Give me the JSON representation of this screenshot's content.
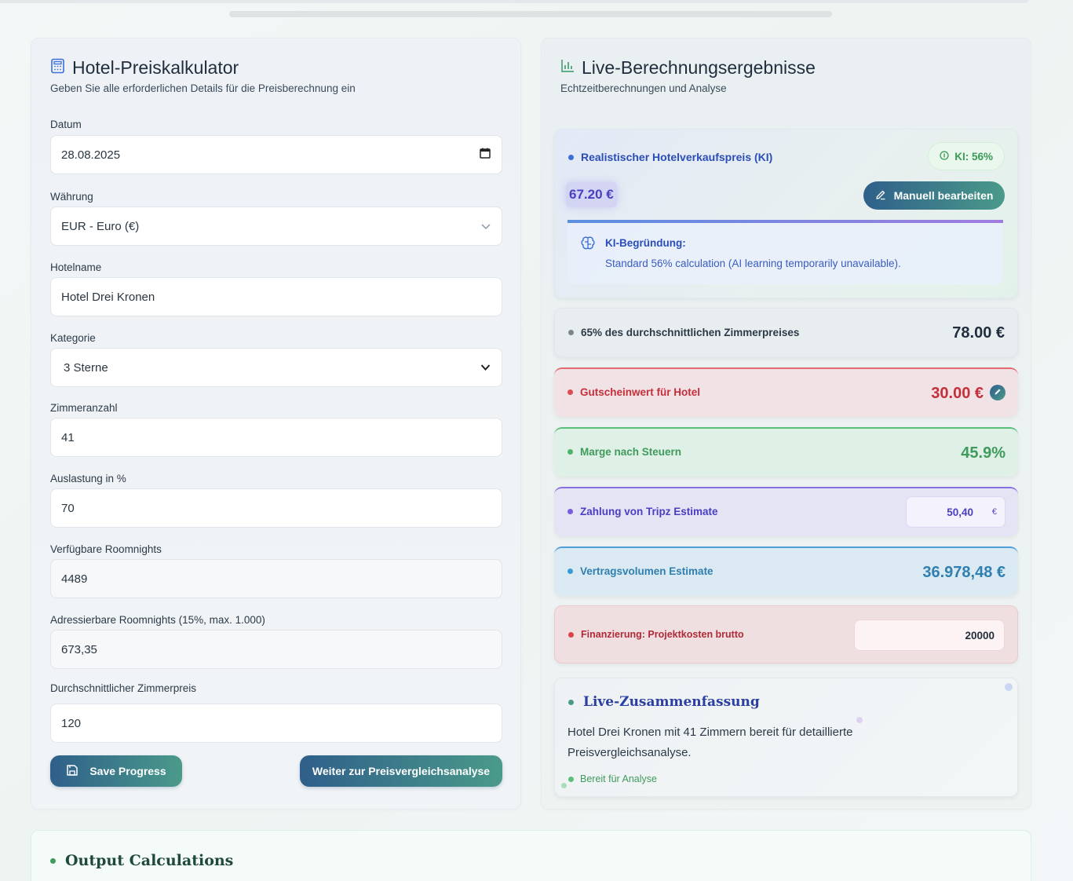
{
  "calculator": {
    "title": "Hotel-Preiskalkulator",
    "subtitle": "Geben Sie alle erforderlichen Details für die Preisberechnung ein",
    "fields": {
      "datum": {
        "label": "Datum",
        "value": "28.08.2025"
      },
      "waehrung": {
        "label": "Währung",
        "value": "EUR - Euro (€)"
      },
      "hotelname": {
        "label": "Hotelname",
        "value": "Hotel Drei Kronen"
      },
      "kategorie": {
        "label": "Kategorie",
        "value": "3 Sterne"
      },
      "zimmeranzahl": {
        "label": "Zimmeranzahl",
        "value": "41"
      },
      "auslastung": {
        "label": "Auslastung in %",
        "value": "70"
      },
      "verfuegbar": {
        "label": "Verfügbare Roomnights",
        "value": "4489"
      },
      "adressierbar": {
        "label": "Adressierbare Roomnights (15%, max. 1.000)",
        "value": "673,35"
      },
      "zimmerpreis": {
        "label": "Durchschnittlicher Zimmerpreis",
        "value": "120"
      }
    },
    "save_label": "Save Progress",
    "next_label": "Weiter zur Preisvergleichsanalyse"
  },
  "results": {
    "title": "Live-Berechnungsergebnisse",
    "subtitle": "Echtzeitberechnungen und Analyse",
    "ki": {
      "label": "Realistischer Hotelverkaufspreis (KI)",
      "badge": "KI: 56%",
      "value": "67.20 €",
      "edit_label": "Manuell bearbeiten",
      "reason_title": "KI-Begründung:",
      "reason_text": "Standard 56% calculation (AI learning temporarily unavailable)."
    },
    "avg_room": {
      "label": "65% des durchschnittlichen Zimmerpreises",
      "value": "78.00 €"
    },
    "voucher": {
      "label": "Gutscheinwert für Hotel",
      "value": "30.00 €"
    },
    "margin": {
      "label": "Marge nach Steuern",
      "value": "45.9%"
    },
    "tripz": {
      "label": "Zahlung von Tripz Estimate",
      "value": "50,40",
      "unit": "€"
    },
    "contract": {
      "label": "Vertragsvolumen Estimate",
      "value": "36.978,48 €"
    },
    "financing": {
      "label": "Finanzierung: Projektkosten brutto",
      "value": "20000"
    },
    "summary": {
      "title": "Live-Zusammenfassung",
      "text": "Hotel Drei Kronen mit 41 Zimmern bereit für detaillierte Preisvergleichsanalyse.",
      "status": "Bereit für Analyse"
    }
  },
  "output": {
    "title": "Output Calculations"
  },
  "colors": {
    "primary_gradient_start": "#2f5f8a",
    "primary_gradient_end": "#4a9a8a",
    "red": "#c62f3a",
    "green": "#3f9a5c",
    "purple": "#5b3fc4",
    "blue": "#2f7fb0"
  }
}
